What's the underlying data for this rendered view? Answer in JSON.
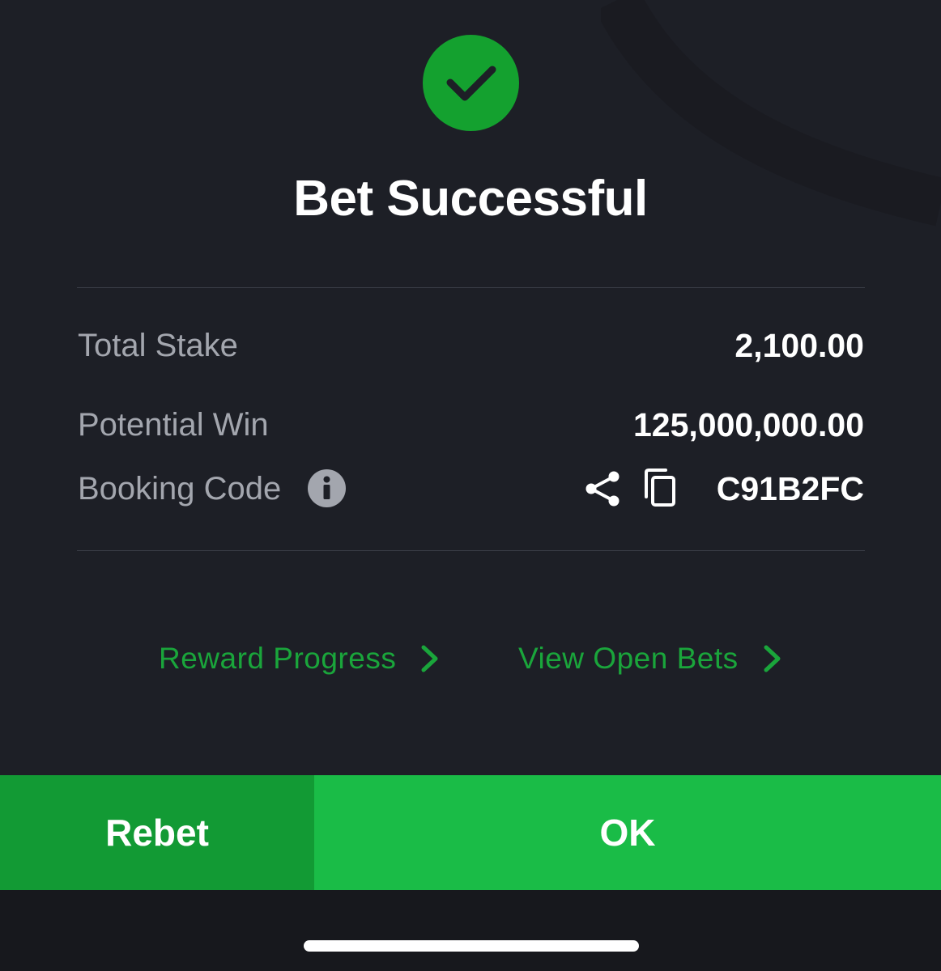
{
  "title": "Bet Successful",
  "summary": {
    "total_stake_label": "Total Stake",
    "total_stake_value": "2,100.00",
    "potential_win_label": "Potential Win",
    "potential_win_value": "125,000,000.00",
    "booking_code_label": "Booking Code",
    "booking_code_value": "C91B2FC"
  },
  "links": {
    "reward_progress": "Reward Progress",
    "view_open_bets": "View Open Bets"
  },
  "buttons": {
    "rebet": "Rebet",
    "ok": "OK"
  },
  "icons": {
    "status": "check-icon",
    "info": "info-icon",
    "share": "share-icon",
    "copy": "copy-icon",
    "chevron": "chevron-right-icon"
  },
  "colors": {
    "background": "#1d1f26",
    "success_green": "#14a12f",
    "link_green": "#1aa53b",
    "rebet_button": "#129a34",
    "ok_button": "#1abc47"
  }
}
